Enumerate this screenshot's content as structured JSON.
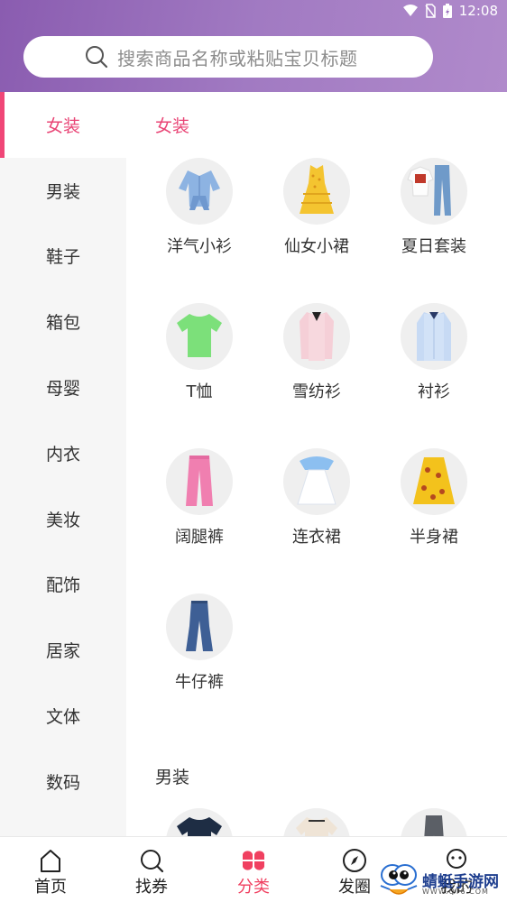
{
  "status_bar": {
    "time": "12:08"
  },
  "search": {
    "placeholder": "搜索商品名称或粘贴宝贝标题"
  },
  "sidebar": {
    "items": [
      {
        "label": "女装",
        "active": true
      },
      {
        "label": "男装"
      },
      {
        "label": "鞋子"
      },
      {
        "label": "箱包"
      },
      {
        "label": "母婴"
      },
      {
        "label": "内衣"
      },
      {
        "label": "美妆"
      },
      {
        "label": "配饰"
      },
      {
        "label": "居家"
      },
      {
        "label": "文体"
      },
      {
        "label": "数码"
      }
    ]
  },
  "content": {
    "section_women": "女装",
    "women_items": [
      {
        "label": "洋气小衫",
        "icon": "blouse-icon"
      },
      {
        "label": "仙女小裙",
        "icon": "yellow-dress-icon"
      },
      {
        "label": "夏日套装",
        "icon": "outfit-set-icon"
      },
      {
        "label": "T恤",
        "icon": "tshirt-icon"
      },
      {
        "label": "雪纺衫",
        "icon": "chiffon-shirt-icon"
      },
      {
        "label": "衬衫",
        "icon": "shirt-icon"
      },
      {
        "label": "阔腿裤",
        "icon": "wide-pants-icon"
      },
      {
        "label": "连衣裙",
        "icon": "dress-icon"
      },
      {
        "label": "半身裙",
        "icon": "skirt-icon"
      },
      {
        "label": "牛仔裤",
        "icon": "jeans-icon"
      }
    ],
    "section_men": "男装"
  },
  "tabbar": {
    "tabs": [
      {
        "label": "首页",
        "icon": "home-icon"
      },
      {
        "label": "找券",
        "icon": "search-icon"
      },
      {
        "label": "分类",
        "icon": "category-icon",
        "active": true
      },
      {
        "label": "发圈",
        "icon": "compass-icon"
      },
      {
        "label": "我的",
        "icon": "profile-icon"
      }
    ]
  },
  "watermark": {
    "text": "蜻蜓手游网",
    "url": "WWW.QT6.COM"
  },
  "colors": {
    "accent": "#f04677",
    "header_start": "#8a5cb0",
    "header_end": "#b08acb"
  }
}
